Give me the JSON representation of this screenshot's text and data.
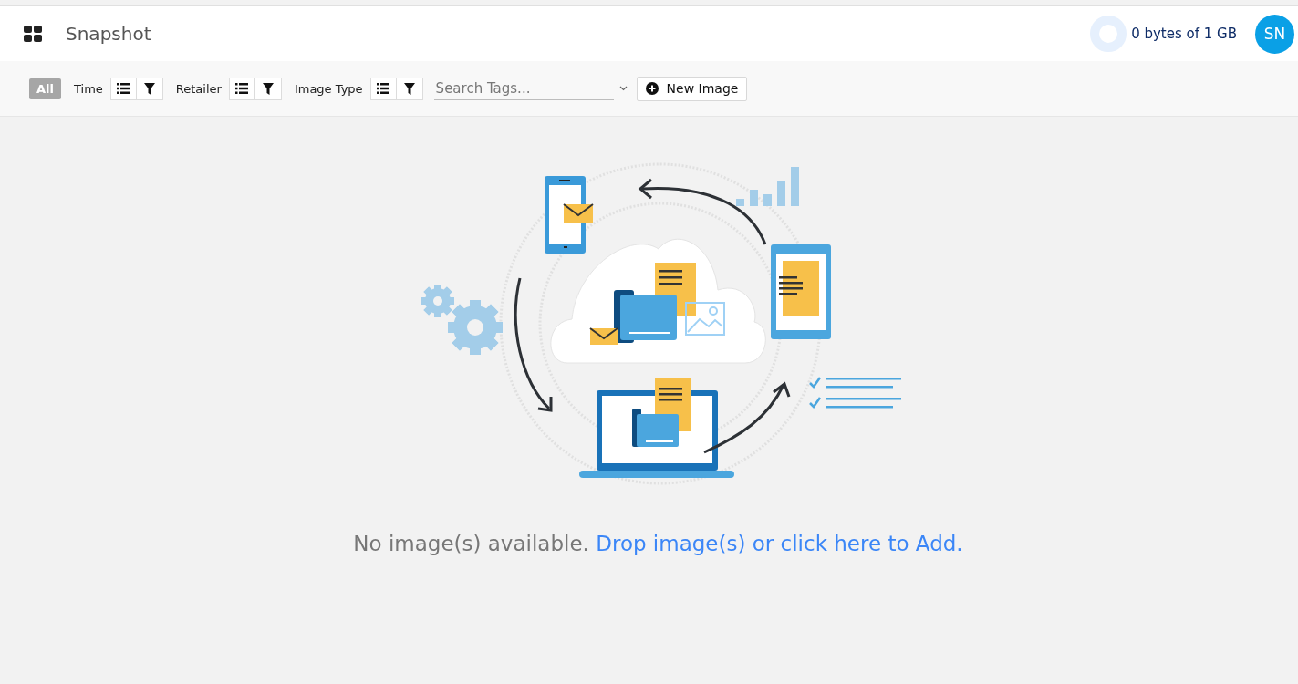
{
  "header": {
    "title": "Snapshot",
    "storage": {
      "text": "0 bytes of 1 GB"
    },
    "avatar": "SN"
  },
  "toolbar": {
    "all": {
      "label": "All",
      "selected": true
    },
    "filters": [
      {
        "label": "Time"
      },
      {
        "label": "Retailer"
      },
      {
        "label": "Image Type"
      }
    ],
    "search": {
      "placeholder": "Search Tags..."
    },
    "new_button": "New Image"
  },
  "empty_state": {
    "message": "No image(s) available.",
    "link": "Drop image(s) or click here to Add."
  }
}
